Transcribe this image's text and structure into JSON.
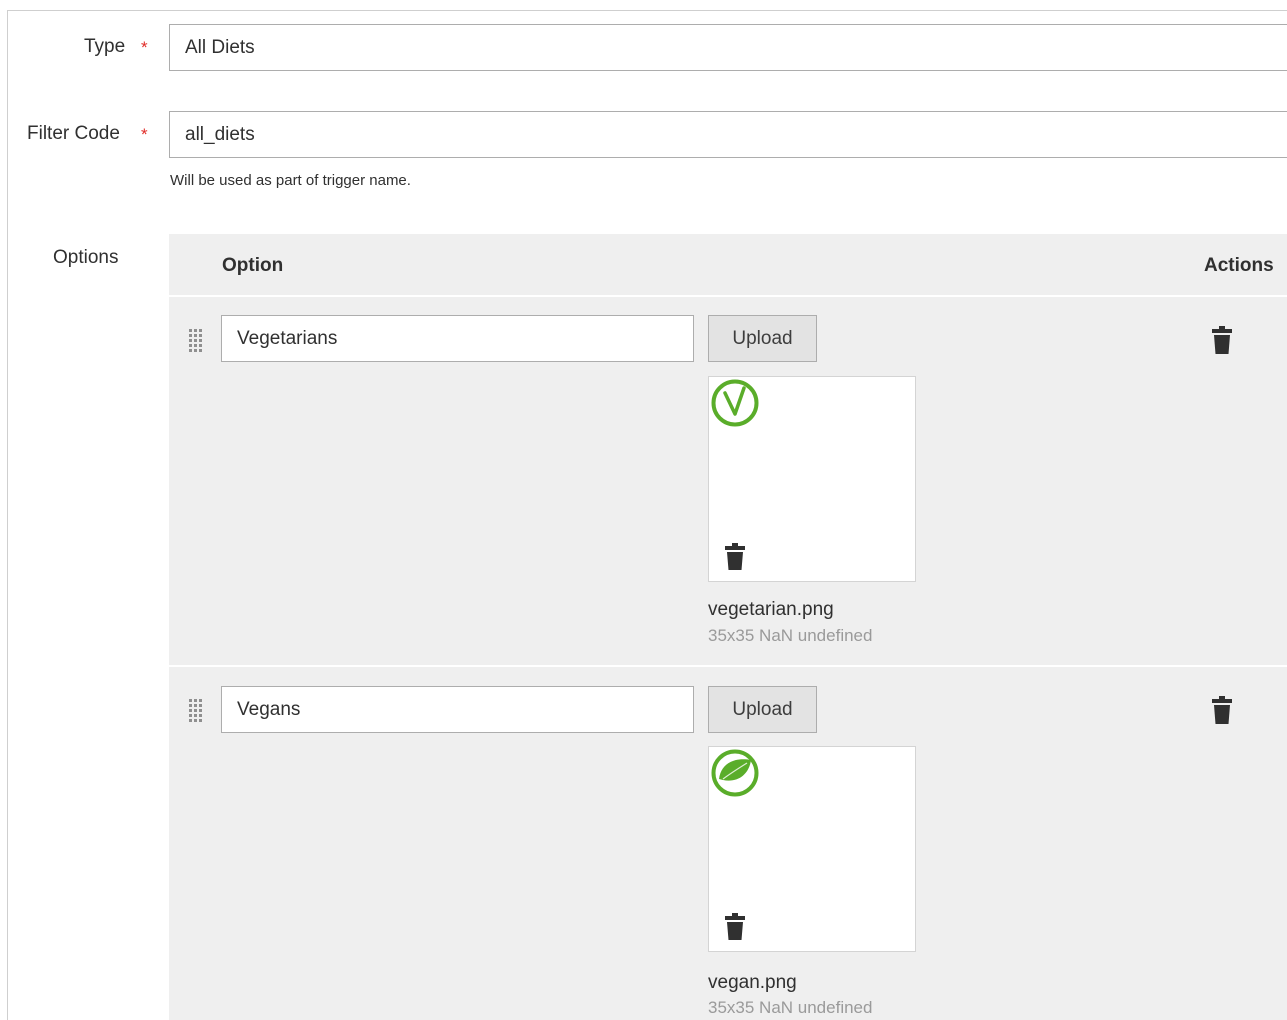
{
  "form": {
    "type_label": "Type",
    "type_value": "All Diets",
    "filter_code_label": "Filter Code",
    "filter_code_value": "all_diets",
    "filter_code_note": "Will be used as part of trigger name.",
    "required_mark": "*",
    "options_label": "Options"
  },
  "options_table": {
    "col_option": "Option",
    "col_actions": "Actions",
    "upload_label": "Upload",
    "rows": [
      {
        "value": "Vegetarians",
        "file_name": "vegetarian.png",
        "file_meta": "35x35 NaN undefined",
        "icon": "vegetarian-v-icon"
      },
      {
        "value": "Vegans",
        "file_name": "vegan.png",
        "file_meta": "35x35 NaN undefined",
        "icon": "vegan-leaf-icon"
      }
    ]
  },
  "colors": {
    "required": "#e02b27",
    "icon_green": "#5aad2a",
    "panel_bg": "#efefef"
  }
}
